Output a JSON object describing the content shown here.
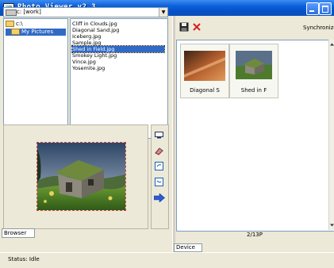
{
  "window": {
    "title": "Photo Viewer v2.3"
  },
  "browser": {
    "drive_value": "c: [work]",
    "folders": [
      "c:\\",
      "My Pictures"
    ],
    "selected_folder": 1,
    "files": [
      "Cliff in Clouds.jpg",
      "Diagonal Sand.jpg",
      "Iceberg.jpg",
      "Sample.jpg",
      "Shed in Field.jpg",
      "Smokey Light.jpg",
      "Vince.jpg",
      "Yosemite.jpg"
    ],
    "selected_file": 4,
    "tab_label": "Browser"
  },
  "device": {
    "sync_label": "Synchronize",
    "thumbnails": [
      {
        "label": "Diagonal S"
      },
      {
        "label": "Shed in F"
      }
    ],
    "counter": "2/13P",
    "tab_label": "Device"
  },
  "status": {
    "text": "Status:   Idle"
  },
  "colors": {
    "selection": "#316ac5",
    "titlebar": "#0a5fd8",
    "delete": "#d42020"
  },
  "icons": {
    "toolstrip": [
      "monitor-icon",
      "eraser-icon",
      "copy-icon",
      "paste-icon",
      "send-arrow-icon"
    ],
    "toolbar": [
      "save-icon",
      "delete-icon"
    ]
  }
}
